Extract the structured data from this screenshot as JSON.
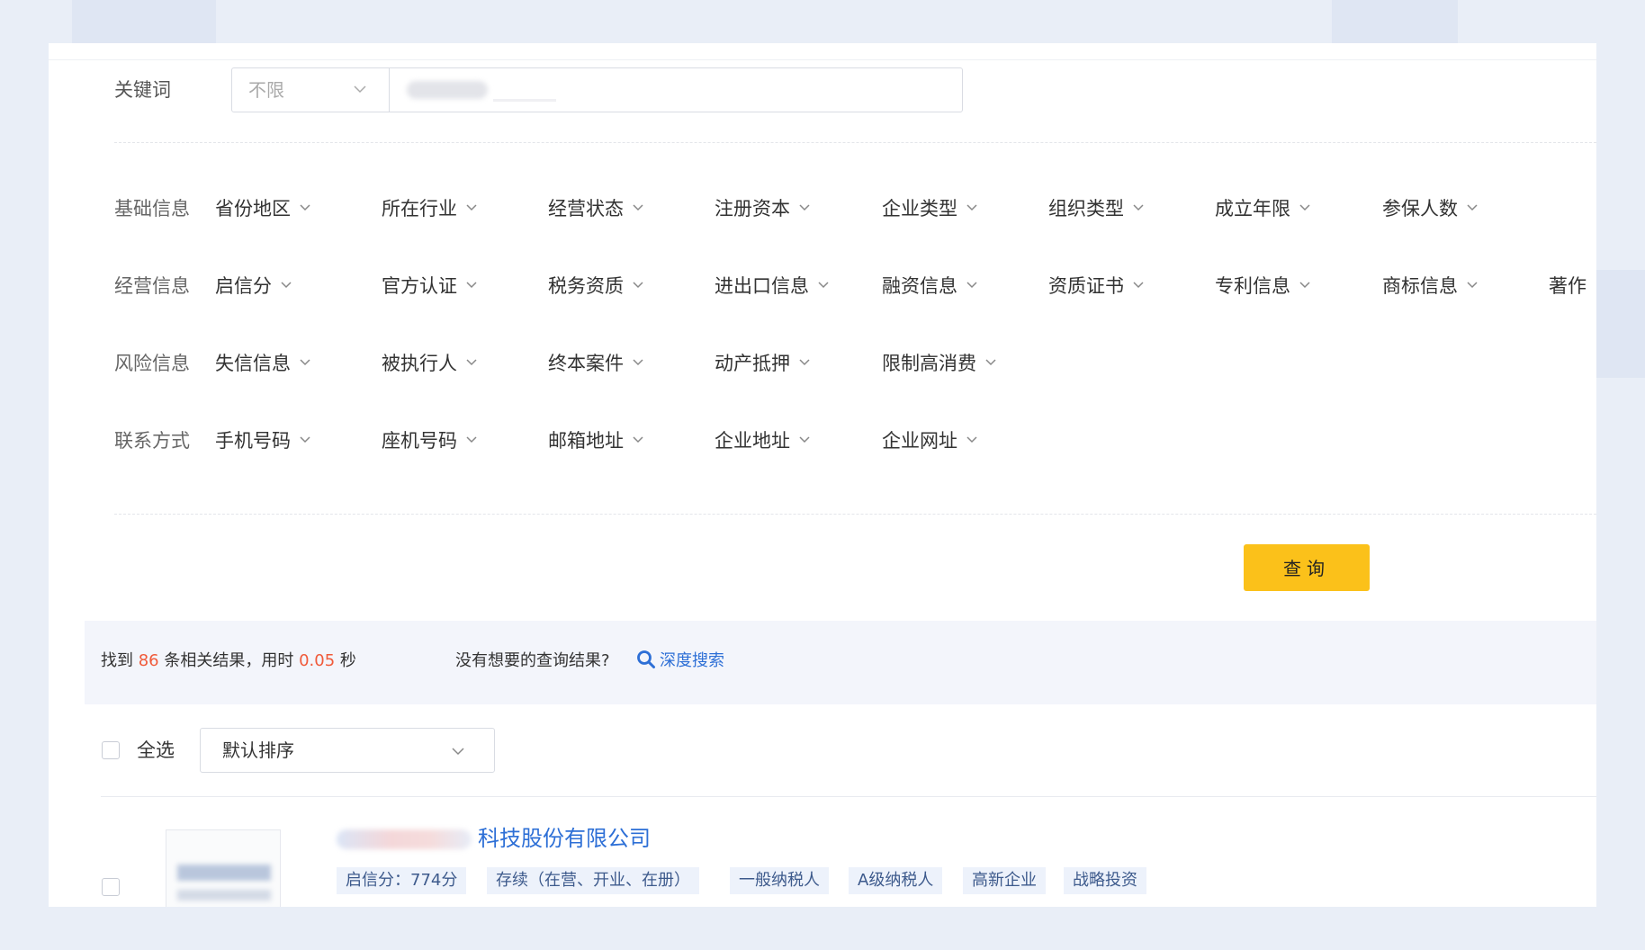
{
  "keyword": {
    "label": "关键词",
    "scope_value": "不限",
    "input_value": ""
  },
  "filters": [
    {
      "label": "基础信息",
      "items": [
        "省份地区",
        "所在行业",
        "经营状态",
        "注册资本",
        "企业类型",
        "组织类型",
        "成立年限",
        "参保人数"
      ]
    },
    {
      "label": "经营信息",
      "items": [
        "启信分",
        "官方认证",
        "税务资质",
        "进出口信息",
        "融资信息",
        "资质证书",
        "专利信息",
        "商标信息",
        "著作"
      ]
    },
    {
      "label": "风险信息",
      "items": [
        "失信信息",
        "被执行人",
        "终本案件",
        "动产抵押",
        "限制高消费"
      ]
    },
    {
      "label": "联系方式",
      "items": [
        "手机号码",
        "座机号码",
        "邮箱地址",
        "企业地址",
        "企业网址"
      ]
    }
  ],
  "query_button": "查询",
  "summary": {
    "prefix": "找到",
    "count": "86",
    "middle": "条相关结果，用时",
    "time": "0.05",
    "suffix": "秒",
    "question": "没有想要的查询结果?",
    "deep_search": "深度搜索"
  },
  "select_all": "全选",
  "sort": {
    "value": "默认排序"
  },
  "results": [
    {
      "name_visible": "科技股份有限公司",
      "tags": [
        "启信分：774分",
        "存续（在营、开业、在册）",
        "一般纳税人",
        "A级纳税人",
        "高新企业",
        "战略投资"
      ]
    }
  ],
  "colors": {
    "accent_yellow": "#fbc11a",
    "link_blue": "#2d6fd6",
    "highlight_red": "#f05a3a",
    "summary_bg": "#f3f5fb",
    "tag_bg": "#edf2fb"
  }
}
